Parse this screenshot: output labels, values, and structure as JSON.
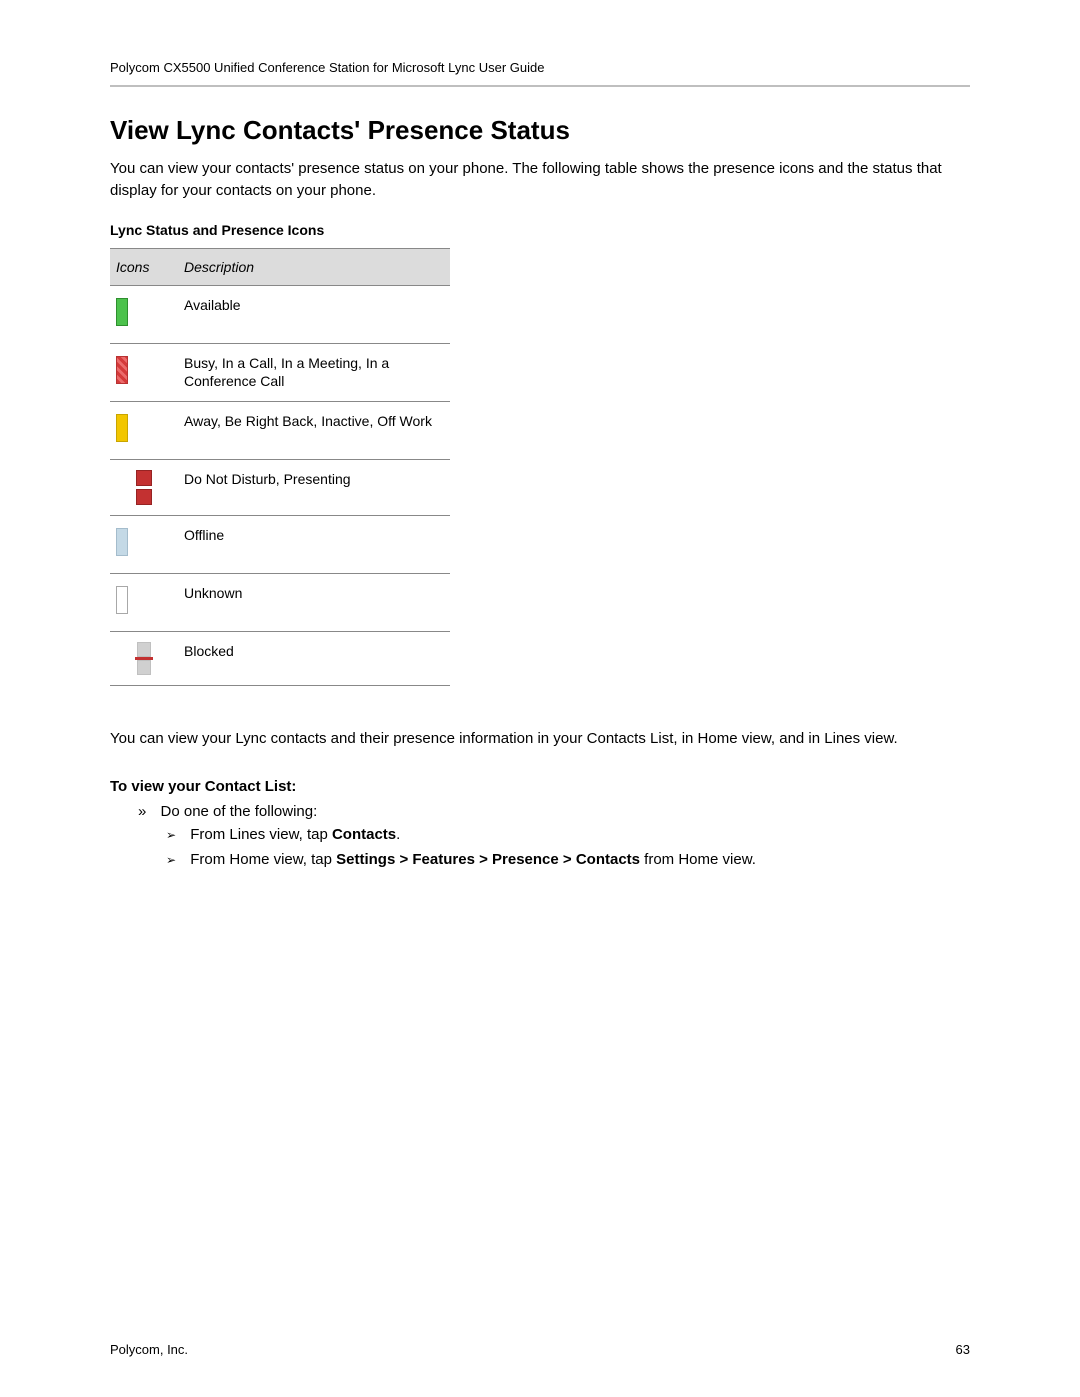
{
  "header": "Polycom CX5500 Unified Conference Station for Microsoft Lync User Guide",
  "title": "View Lync Contacts' Presence Status",
  "intro": "You can view your contacts' presence status on your phone. The following table shows the presence icons and the status that display for your contacts on your phone.",
  "table": {
    "caption": "Lync Status and Presence Icons",
    "col_icons": "Icons",
    "col_desc": "Description",
    "rows": [
      {
        "icon": "available",
        "desc": "Available"
      },
      {
        "icon": "busy",
        "desc": "Busy, In a Call, In a Meeting, In a Conference Call"
      },
      {
        "icon": "away",
        "desc": "Away, Be Right Back, Inactive, Off Work"
      },
      {
        "icon": "dnd",
        "desc": "Do Not Disturb, Presenting"
      },
      {
        "icon": "offline",
        "desc": "Offline"
      },
      {
        "icon": "unknown",
        "desc": "Unknown"
      },
      {
        "icon": "blocked",
        "desc": "Blocked"
      }
    ]
  },
  "body2": "You can view your Lync contacts and their presence information in your Contacts List, in Home view, and in Lines view.",
  "subhead": "To view your Contact List:",
  "lvl1": "Do one of the following:",
  "lvl2": [
    {
      "prefix": "From Lines view, tap ",
      "bold": "Contacts",
      "suffix": "."
    },
    {
      "prefix": "From Home view, tap ",
      "bold": "Settings > Features > Presence > Contacts",
      "suffix": " from Home view."
    }
  ],
  "footer": {
    "left": "Polycom, Inc.",
    "right": "63"
  }
}
